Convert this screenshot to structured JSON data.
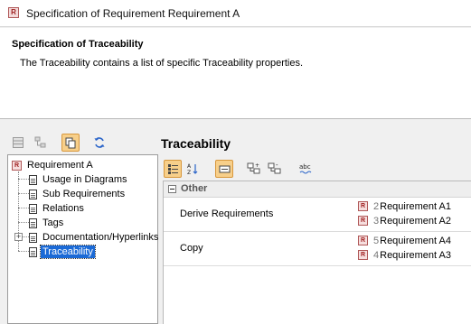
{
  "window": {
    "title": "Specification of Requirement Requirement A",
    "icon": "requirement-icon",
    "icon_letter": "R"
  },
  "header": {
    "title": "Specification of Traceability",
    "description": "The Traceability contains a list of specific Traceability properties."
  },
  "left_toolbar": {
    "buttons": [
      {
        "icon": "table-view-icon",
        "active": false
      },
      {
        "icon": "tree-view-icon",
        "active": false
      },
      {
        "icon": "copy-icon",
        "active": true
      },
      {
        "icon": "refresh-icon",
        "active": false
      }
    ]
  },
  "tree": {
    "root": {
      "label": "Requirement A",
      "icon_letter": "R"
    },
    "items": [
      {
        "label": "Usage in Diagrams",
        "expandable": false,
        "selected": false
      },
      {
        "label": "Sub Requirements",
        "expandable": false,
        "selected": false
      },
      {
        "label": "Relations",
        "expandable": false,
        "selected": false
      },
      {
        "label": "Tags",
        "expandable": false,
        "selected": false
      },
      {
        "label": "Documentation/Hyperlinks",
        "expandable": true,
        "selected": false
      },
      {
        "label": "Traceability",
        "expandable": false,
        "selected": true
      }
    ]
  },
  "panel": {
    "title": "Traceability"
  },
  "grid_toolbar": {
    "buttons": [
      {
        "icon": "categorized-view-icon",
        "active": true
      },
      {
        "icon": "sort-alphabetically-icon",
        "active": false
      },
      {
        "icon": "show-description-icon",
        "active": true
      },
      {
        "icon": "expand-all-icon",
        "active": false
      },
      {
        "icon": "collapse-all-icon",
        "active": false
      },
      {
        "icon": "spelling-check-icon",
        "active": false
      }
    ]
  },
  "properties": {
    "group_label": "Other",
    "rows": [
      {
        "name": "Derive Requirements",
        "values": [
          {
            "number": "2",
            "label": "Requirement A1",
            "icon_letter": "R"
          },
          {
            "number": "3",
            "label": "Requirement A2",
            "icon_letter": "R"
          }
        ]
      },
      {
        "name": "Copy",
        "values": [
          {
            "number": "5",
            "label": "Requirement A4",
            "icon_letter": "R"
          },
          {
            "number": "4",
            "label": "Requirement A3",
            "icon_letter": "R"
          }
        ]
      }
    ]
  },
  "colors": {
    "selection": "#1b6ad6",
    "active_button": "#f7cf8a",
    "requirement_icon_border": "#b05858"
  }
}
